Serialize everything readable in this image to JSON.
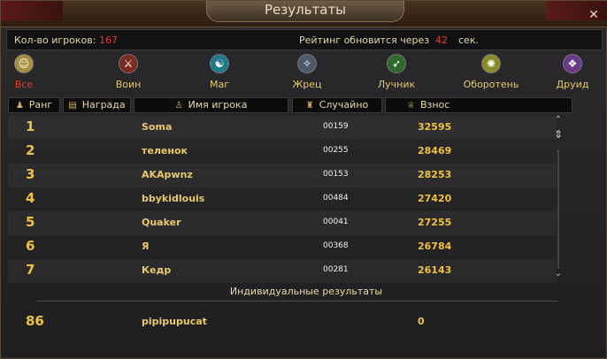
{
  "window": {
    "title": "Результаты",
    "close_glyph": "✕"
  },
  "info": {
    "players_label": "Кол-во игроков:",
    "players_count": "167",
    "rating_label": "Рейтинг обновится через",
    "rating_seconds": "42",
    "rating_unit": "сек."
  },
  "classes": [
    {
      "label": "Все",
      "icon": "smiley-icon",
      "glyph": "☺",
      "color": "#a89040",
      "active": true
    },
    {
      "label": "Воин",
      "icon": "warrior-icon",
      "glyph": "⚔",
      "color": "#7a2a20"
    },
    {
      "label": "Маг",
      "icon": "mage-icon",
      "glyph": "☯",
      "color": "#1e7a8a"
    },
    {
      "label": "Жрец",
      "icon": "priest-icon",
      "glyph": "✧",
      "color": "#4a5a6a"
    },
    {
      "label": "Лучник",
      "icon": "archer-icon",
      "glyph": "➶",
      "color": "#2e6a2a"
    },
    {
      "label": "Оборотень",
      "icon": "werewolf-icon",
      "glyph": "✺",
      "color": "#8a8a2a"
    },
    {
      "label": "Друид",
      "icon": "druid-icon",
      "glyph": "❖",
      "color": "#6a3a8a"
    }
  ],
  "columns": [
    {
      "label": "Ранг",
      "icon": "rank-icon",
      "glyph": "♟"
    },
    {
      "label": "Награда",
      "icon": "reward-icon",
      "glyph": "▤"
    },
    {
      "label": "Имя игрока",
      "icon": "player-icon",
      "glyph": "♙"
    },
    {
      "label": "Случайно",
      "icon": "random-icon",
      "glyph": "♜"
    },
    {
      "label": "Взнос",
      "icon": "trophy-icon",
      "glyph": "♕"
    }
  ],
  "rows": [
    {
      "rank": "1",
      "name": "Soma",
      "random": "00159",
      "fee": "32595"
    },
    {
      "rank": "2",
      "name": "теленок",
      "random": "00255",
      "fee": "28469"
    },
    {
      "rank": "3",
      "name": "AKApwnz",
      "random": "00153",
      "fee": "28253"
    },
    {
      "rank": "4",
      "name": "bbykidlouis",
      "random": "00484",
      "fee": "27420"
    },
    {
      "rank": "5",
      "name": "Quaker",
      "random": "00041",
      "fee": "27255"
    },
    {
      "rank": "6",
      "name": "Я",
      "random": "00368",
      "fee": "26784"
    },
    {
      "rank": "7",
      "name": "Кедр",
      "random": "00281",
      "fee": "26143"
    }
  ],
  "individual": {
    "title": "Индивидуальные результаты",
    "rank": "86",
    "name": "pipipupucat",
    "fee": "0"
  }
}
